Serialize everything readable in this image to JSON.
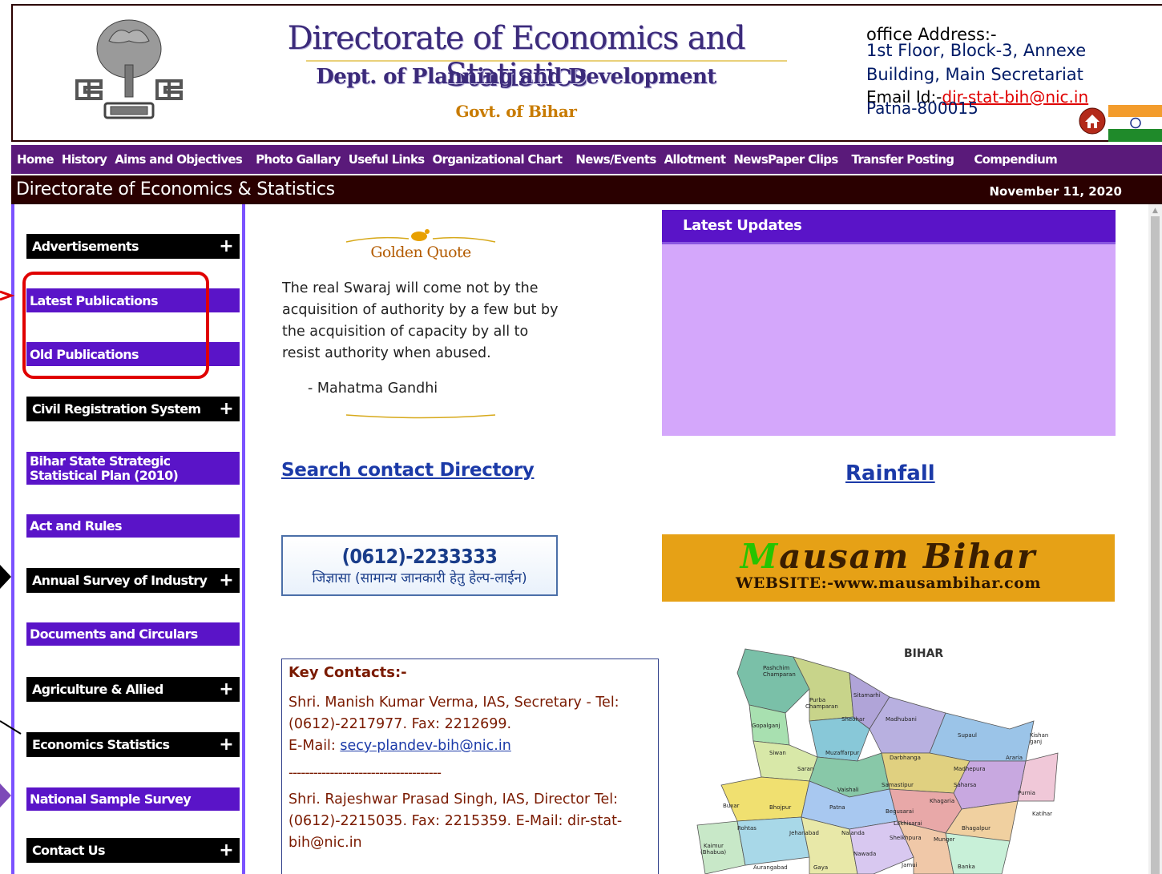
{
  "header": {
    "title": "Directorate of Economics and Statistics",
    "dept": "Dept. of Planning and Development",
    "govt": "Govt. of Bihar",
    "office_label": "office Address:-",
    "office_line1": "1st Floor, Block-3, Annexe",
    "office_line2": "Building, Main Secretariat",
    "email_prefix": "Email Id:-",
    "email": "dir-stat-bih@nic.in",
    "office_line3": "Patna-800015"
  },
  "nav": {
    "items": [
      "Home",
      "History",
      "Aims and Objectives",
      "Photo Gallary",
      "Useful Links",
      "Organizational Chart",
      "News/Events",
      "Allotment",
      "NewsPaper Clips",
      "Transfer Posting",
      "Compendium"
    ]
  },
  "titlebar": {
    "site_name": "Directorate of Economics & Statistics",
    "date": "November 11, 2020"
  },
  "sidebar": {
    "items": [
      {
        "label": "Advertisements",
        "style": "black",
        "expandable": true
      },
      {
        "label": "Latest Publications",
        "style": "purple",
        "expandable": false
      },
      {
        "label": "Old Publications",
        "style": "purple",
        "expandable": false
      },
      {
        "label": "Civil Registration System",
        "style": "black",
        "expandable": true
      },
      {
        "label": "Bihar State Strategic Statistical Plan (2010)",
        "style": "purple",
        "expandable": false
      },
      {
        "label": "Act and Rules",
        "style": "purple",
        "expandable": false
      },
      {
        "label": "Annual Survey of Industry",
        "style": "black",
        "expandable": true
      },
      {
        "label": "Documents and Circulars",
        "style": "purple",
        "expandable": false
      },
      {
        "label": "Agriculture & Allied",
        "style": "black",
        "expandable": true
      },
      {
        "label": "Economics Statistics",
        "style": "black",
        "expandable": true
      },
      {
        "label": "National Sample Survey",
        "style": "purple",
        "expandable": false
      },
      {
        "label": "Contact Us",
        "style": "black",
        "expandable": true
      }
    ],
    "plus_symbol": "+"
  },
  "golden_quote": {
    "title": "Golden Quote",
    "text": "The real Swaraj will come not by the acquisition of authority by a few but by the acquisition of capacity by all to resist authority when abused.",
    "author": "- Mahatma Gandhi"
  },
  "latest_updates": {
    "title": "Latest Updates"
  },
  "links": {
    "search": "Search contact Directory",
    "rainfall": "Rainfall"
  },
  "helpline": {
    "number": "(0612)-2233333",
    "subtitle": "जिज्ञासा (सामान्य जानकारी हेतु हेल्प-लाईन)"
  },
  "mausam": {
    "title": "Mausam Bihar",
    "website": "WEBSITE:-www.mausambihar.com"
  },
  "key_contacts": {
    "title": "Key Contacts:-",
    "contact1_text": "Shri. Manish Kumar Verma, IAS, Secretary - Tel: (0612)-2217977. Fax: 2212699.",
    "contact1_email_label": "E-Mail:",
    "contact1_email": "secy-plandev-bih@nic.in",
    "separator": "-------------------------------------",
    "contact2_text": "Shri. Rajeshwar Prasad Singh, IAS, Director Tel: (0612)-2215035. Fax: 2215359.  E-Mail: dir-stat-bih@nic.in"
  },
  "map": {
    "title": "BIHAR",
    "districts": [
      "Pashchim Champaran",
      "Purba Champaran",
      "Sitamarhi",
      "Gopalganj",
      "Sheohar",
      "Madhubani",
      "Kishanganj",
      "Siwan",
      "Muzaffarpur",
      "Darbhanga",
      "Supaul",
      "Araria",
      "Saran",
      "Madhepura",
      "Vaishali",
      "Samastipur",
      "Saharsa",
      "Purnia",
      "Buxar",
      "Bhojpur",
      "Patna",
      "Khagaria",
      "Katihar",
      "Begusarai",
      "Rohtas",
      "Jehanabad",
      "Nalanda",
      "Lakhisarai",
      "Bhagalpur",
      "Kaimur (Bhabua)",
      "Sheikhpura",
      "Munger",
      "Nawada",
      "Aurangabad",
      "Gaya",
      "Jamui",
      "Banka"
    ]
  },
  "colors": {
    "nav_bg": "#5a1a7a",
    "titlebar_bg": "#2a0000",
    "sidebar_purple": "#5a14c8",
    "updates_bg": "#d4a7fb",
    "highlight": "#e00000"
  }
}
